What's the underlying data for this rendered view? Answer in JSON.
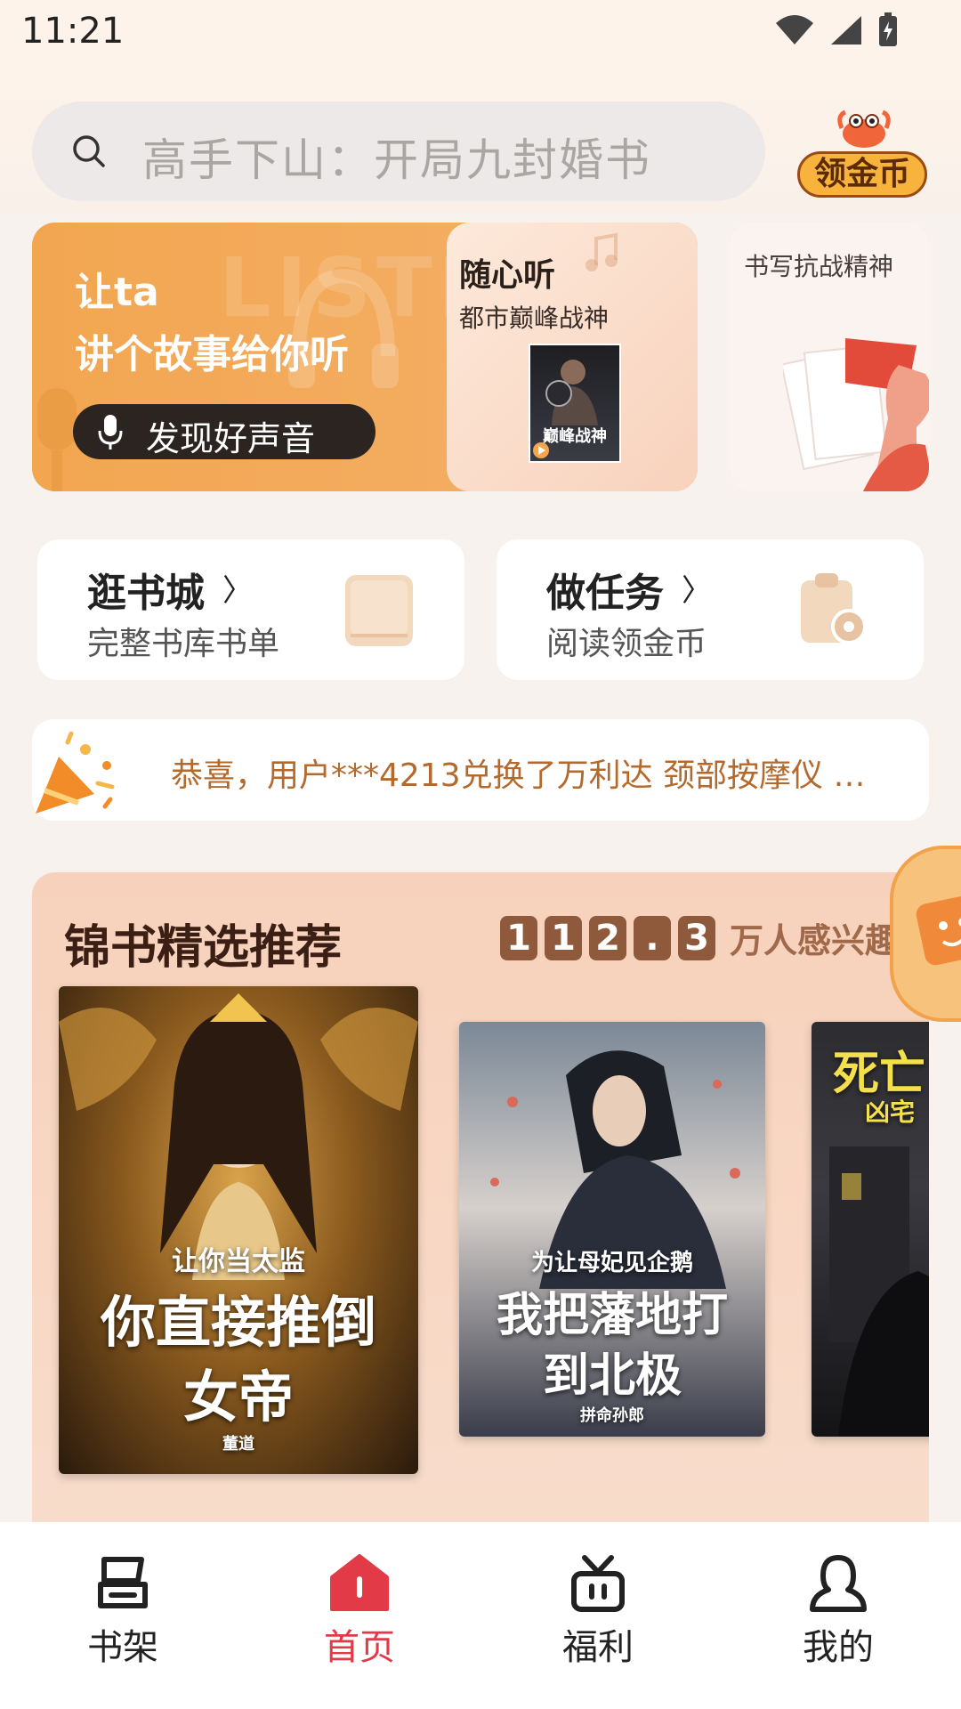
{
  "status_bar": {
    "time": "11:21"
  },
  "search": {
    "placeholder": "高手下山：开局九封婚书"
  },
  "coin_button": {
    "label": "领金币"
  },
  "banner": {
    "bg_word": "LISTEN",
    "title_line1": "让ta",
    "title_line2": "讲个故事给你听",
    "pill_label": "发现好声音",
    "card_title": "随心听",
    "card_subtitle": "都市巅峰战神",
    "card_cover_text": "巅峰战神"
  },
  "side_banner": {
    "title": "书写抗战精神"
  },
  "shortcuts": [
    {
      "title": "逛书城",
      "arrow": "〉",
      "subtitle": "完整书库书单"
    },
    {
      "title": "做任务",
      "arrow": "〉",
      "subtitle": "阅读领金币"
    }
  ],
  "notice": {
    "text": "恭喜，用户***4213兑换了万利达 颈部按摩仪 …"
  },
  "recommend": {
    "title": "锦书精选推荐",
    "count_digits": [
      "1",
      "1",
      "2",
      ".",
      "3"
    ],
    "count_suffix": "万人感兴趣",
    "books": [
      {
        "top_text": "让你当太监",
        "main_text": "你直接推倒女帝",
        "author": "董道"
      },
      {
        "top_text": "为让母妃见企鹅",
        "main_text": "我把藩地打到北极",
        "author": "拼命孙郎"
      },
      {
        "top_text": "死亡",
        "main_text": "凶宅",
        "author": ""
      }
    ]
  },
  "bottom_nav": [
    {
      "label": "书架",
      "icon": "bookshelf-icon",
      "active": false
    },
    {
      "label": "首页",
      "icon": "home-icon",
      "active": true
    },
    {
      "label": "福利",
      "icon": "gift-icon",
      "active": false
    },
    {
      "label": "我的",
      "icon": "profile-icon",
      "active": false
    }
  ],
  "colors": {
    "accent": "#e23a46",
    "banner_orange": "#f2a650",
    "count_brown": "#8f5a3c"
  }
}
